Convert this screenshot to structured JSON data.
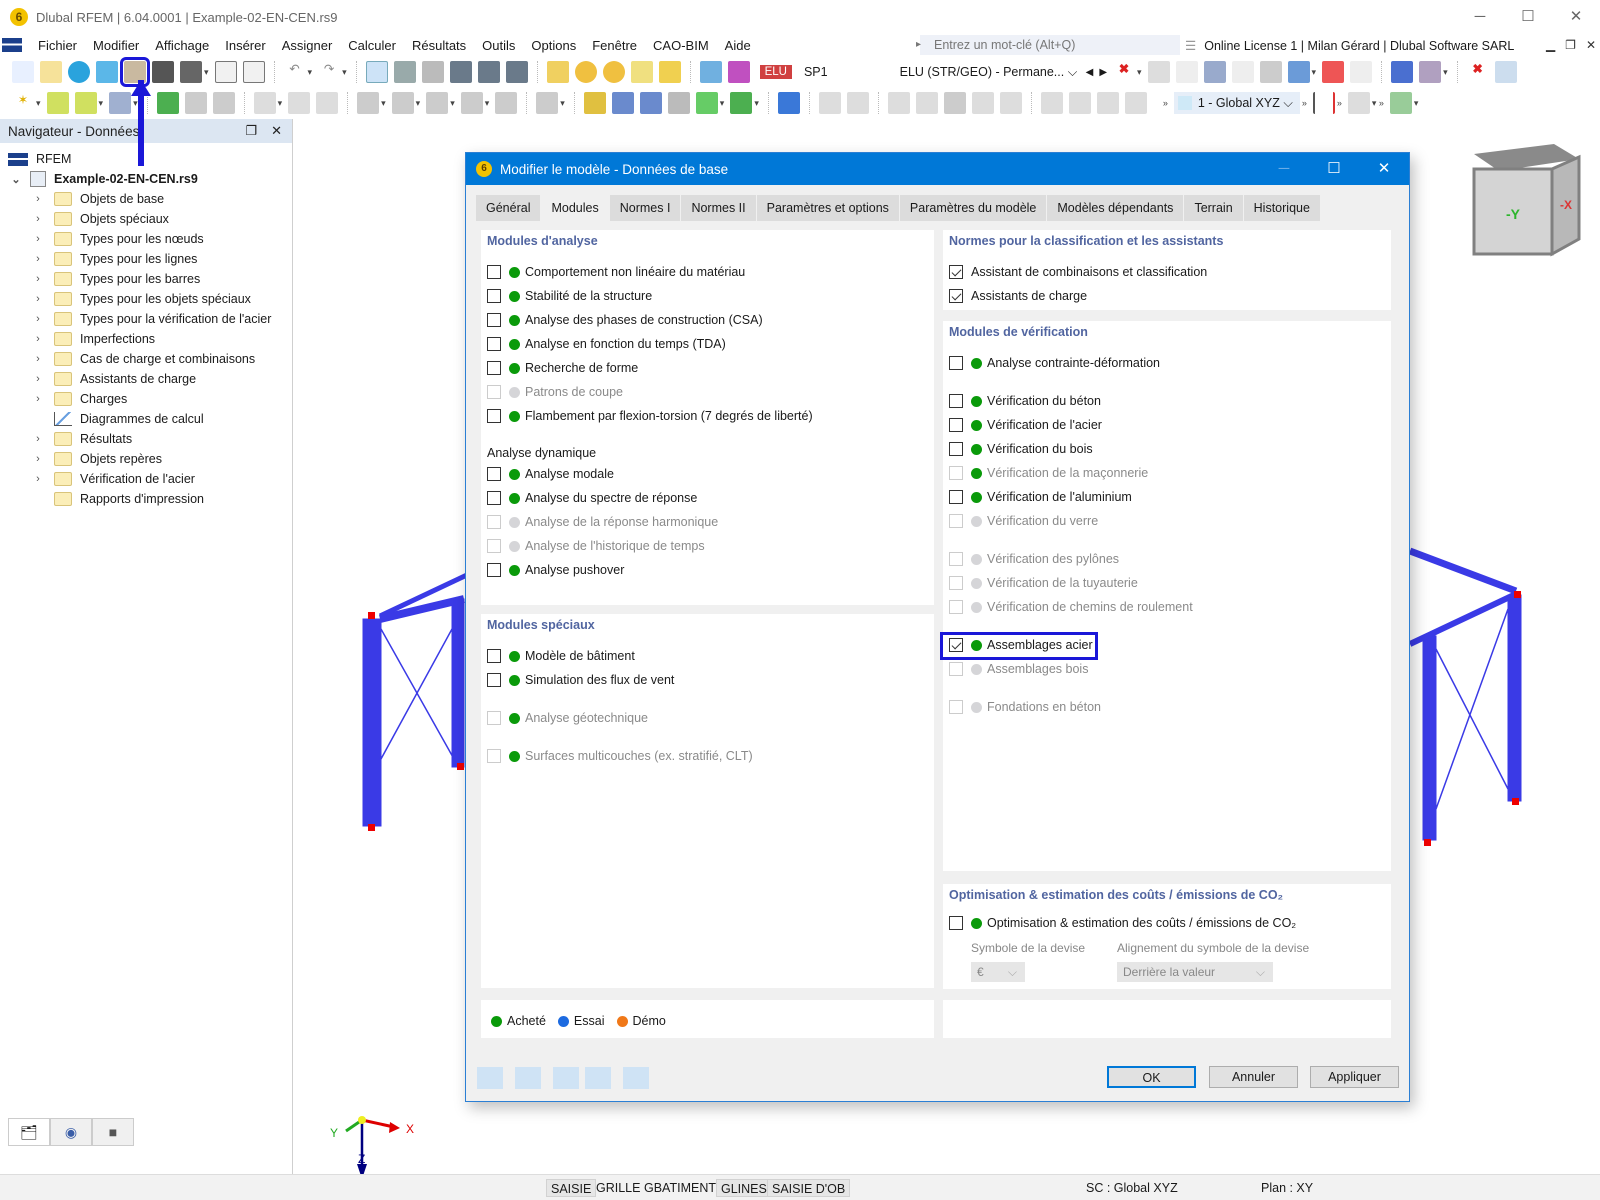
{
  "window": {
    "title": "Dlubal RFEM | 6.04.0001 | Example-02-EN-CEN.rs9",
    "controls": [
      "minimize",
      "maximize",
      "close"
    ]
  },
  "menu": {
    "items": [
      "Fichier",
      "Modifier",
      "Affichage",
      "Insérer",
      "Assigner",
      "Calculer",
      "Résultats",
      "Outils",
      "Options",
      "Fenêtre",
      "CAO-BIM",
      "Aide"
    ],
    "search_placeholder": "Entrez un mot-clé (Alt+Q)",
    "license": "Online License 1 | Milan Gérard | Dlubal Software SARL"
  },
  "toolbar": {
    "highlighted_button": "edit-model-base-data-icon",
    "load_badge": "ELU",
    "load_case": "SP1",
    "combination": "ELU (STR/GEO) - Permane...",
    "coord_system": "1 - Global XYZ"
  },
  "navigator": {
    "title": "Navigateur - Données",
    "root": "RFEM",
    "file": "Example-02-EN-CEN.rs9",
    "items": [
      {
        "label": "Objets de base",
        "type": "folder"
      },
      {
        "label": "Objets spéciaux",
        "type": "folder"
      },
      {
        "label": "Types pour les nœuds",
        "type": "folder"
      },
      {
        "label": "Types pour les lignes",
        "type": "folder"
      },
      {
        "label": "Types pour les barres",
        "type": "folder"
      },
      {
        "label": "Types pour les objets spéciaux",
        "type": "folder"
      },
      {
        "label": "Types pour la vérification de l'acier",
        "type": "folder"
      },
      {
        "label": "Imperfections",
        "type": "folder"
      },
      {
        "label": "Cas de charge et combinaisons",
        "type": "folder"
      },
      {
        "label": "Assistants de charge",
        "type": "folder"
      },
      {
        "label": "Charges",
        "type": "folder"
      },
      {
        "label": "Diagrammes de calcul",
        "type": "diagram"
      },
      {
        "label": "Résultats",
        "type": "folder"
      },
      {
        "label": "Objets repères",
        "type": "folder"
      },
      {
        "label": "Vérification de l'acier",
        "type": "folder"
      },
      {
        "label": "Rapports d'impression",
        "type": "folder-noexpand"
      }
    ]
  },
  "viewport": {
    "nav_cube": {
      "front": "-Y",
      "right": "-X"
    },
    "axes": {
      "x": "X",
      "y": "Y",
      "z": "Z"
    }
  },
  "dialog": {
    "title": "Modifier le modèle - Données de base",
    "tabs": [
      "Général",
      "Modules",
      "Normes I",
      "Normes II",
      "Paramètres et options",
      "Paramètres du modèle",
      "Modèles dépendants",
      "Terrain",
      "Historique"
    ],
    "active_tab": "Modules",
    "analysis": {
      "title": "Modules d'analyse",
      "items": [
        {
          "label": "Comportement non linéaire du matériau",
          "checked": false,
          "enabled": true,
          "status": "purchased"
        },
        {
          "label": "Stabilité de la structure",
          "checked": false,
          "enabled": true,
          "status": "purchased"
        },
        {
          "label": "Analyse des phases de construction (CSA)",
          "checked": false,
          "enabled": true,
          "status": "purchased"
        },
        {
          "label": "Analyse en fonction du temps (TDA)",
          "checked": false,
          "enabled": true,
          "status": "purchased"
        },
        {
          "label": "Recherche de forme",
          "checked": false,
          "enabled": true,
          "status": "purchased"
        },
        {
          "label": "Patrons de coupe",
          "checked": false,
          "enabled": false,
          "status": "none"
        },
        {
          "label": "Flambement par flexion-torsion (7 degrés de liberté)",
          "checked": false,
          "enabled": true,
          "status": "purchased"
        }
      ],
      "dynamic_title": "Analyse dynamique",
      "dynamic": [
        {
          "label": "Analyse modale",
          "checked": false,
          "enabled": true,
          "status": "purchased"
        },
        {
          "label": "Analyse du spectre de réponse",
          "checked": false,
          "enabled": true,
          "status": "purchased"
        },
        {
          "label": "Analyse de la réponse harmonique",
          "checked": false,
          "enabled": false,
          "status": "none"
        },
        {
          "label": "Analyse de l'historique de temps",
          "checked": false,
          "enabled": false,
          "status": "none"
        },
        {
          "label": "Analyse pushover",
          "checked": false,
          "enabled": true,
          "status": "purchased"
        }
      ]
    },
    "special": {
      "title": "Modules spéciaux",
      "items": [
        {
          "label": "Modèle de bâtiment",
          "checked": false,
          "enabled": true,
          "status": "purchased"
        },
        {
          "label": "Simulation des flux de vent",
          "checked": false,
          "enabled": true,
          "status": "purchased"
        },
        {
          "label": "Analyse géotechnique",
          "checked": false,
          "enabled": false,
          "status": "purchased"
        },
        {
          "label": "Surfaces multicouches (ex. stratifié, CLT)",
          "checked": false,
          "enabled": false,
          "status": "purchased"
        }
      ]
    },
    "standards": {
      "title": "Normes pour la classification et les assistants",
      "items": [
        {
          "label": "Assistant de combinaisons et classification",
          "checked": true
        },
        {
          "label": "Assistants de charge",
          "checked": true
        }
      ]
    },
    "design": {
      "title": "Modules de vérification",
      "items": [
        {
          "label": "Analyse contrainte-déformation",
          "checked": false,
          "enabled": true,
          "status": "purchased"
        },
        {
          "label": "Vérification du béton",
          "checked": false,
          "enabled": true,
          "status": "purchased"
        },
        {
          "label": "Vérification de l'acier",
          "checked": false,
          "enabled": true,
          "status": "purchased"
        },
        {
          "label": "Vérification du bois",
          "checked": false,
          "enabled": true,
          "status": "purchased"
        },
        {
          "label": "Vérification de la maçonnerie",
          "checked": false,
          "enabled": false,
          "status": "purchased"
        },
        {
          "label": "Vérification de l'aluminium",
          "checked": false,
          "enabled": true,
          "status": "purchased"
        },
        {
          "label": "Vérification du verre",
          "checked": false,
          "enabled": false,
          "status": "none"
        },
        {
          "label": "Vérification des pylônes",
          "checked": false,
          "enabled": false,
          "status": "none"
        },
        {
          "label": "Vérification de la tuyauterie",
          "checked": false,
          "enabled": false,
          "status": "none"
        },
        {
          "label": "Vérification de chemins de roulement",
          "checked": false,
          "enabled": false,
          "status": "none"
        },
        {
          "label": "Assemblages acier",
          "checked": true,
          "enabled": true,
          "status": "purchased",
          "highlighted": true
        },
        {
          "label": "Assemblages bois",
          "checked": false,
          "enabled": false,
          "status": "none"
        },
        {
          "label": "Fondations en béton",
          "checked": false,
          "enabled": false,
          "status": "none"
        }
      ]
    },
    "optimization": {
      "title": "Optimisation & estimation des coûts / émissions de CO₂",
      "item": {
        "label": "Optimisation & estimation des coûts / émissions de CO₂",
        "checked": false,
        "status": "purchased"
      },
      "currency_label": "Symbole de la devise",
      "currency_value": "€",
      "alignment_label": "Alignement du symbole de la devise",
      "alignment_value": "Derrière la valeur"
    },
    "legend": [
      {
        "label": "Acheté",
        "color": "#0a9a0a"
      },
      {
        "label": "Essai",
        "color": "#1c6ae0"
      },
      {
        "label": "Démo",
        "color": "#f07818"
      }
    ],
    "buttons": {
      "ok": "OK",
      "cancel": "Annuler",
      "apply": "Appliquer"
    }
  },
  "statusbar": {
    "toggles": [
      {
        "label": "SAISIE",
        "on": true
      },
      {
        "label": "GRILLE",
        "on": false
      },
      {
        "label": "GBATIMENT",
        "on": false
      },
      {
        "label": "GLINES",
        "on": true
      },
      {
        "label": "SAISIE D'OB",
        "on": true
      }
    ],
    "cs": "SC : Global XYZ",
    "plane": "Plan : XY"
  }
}
